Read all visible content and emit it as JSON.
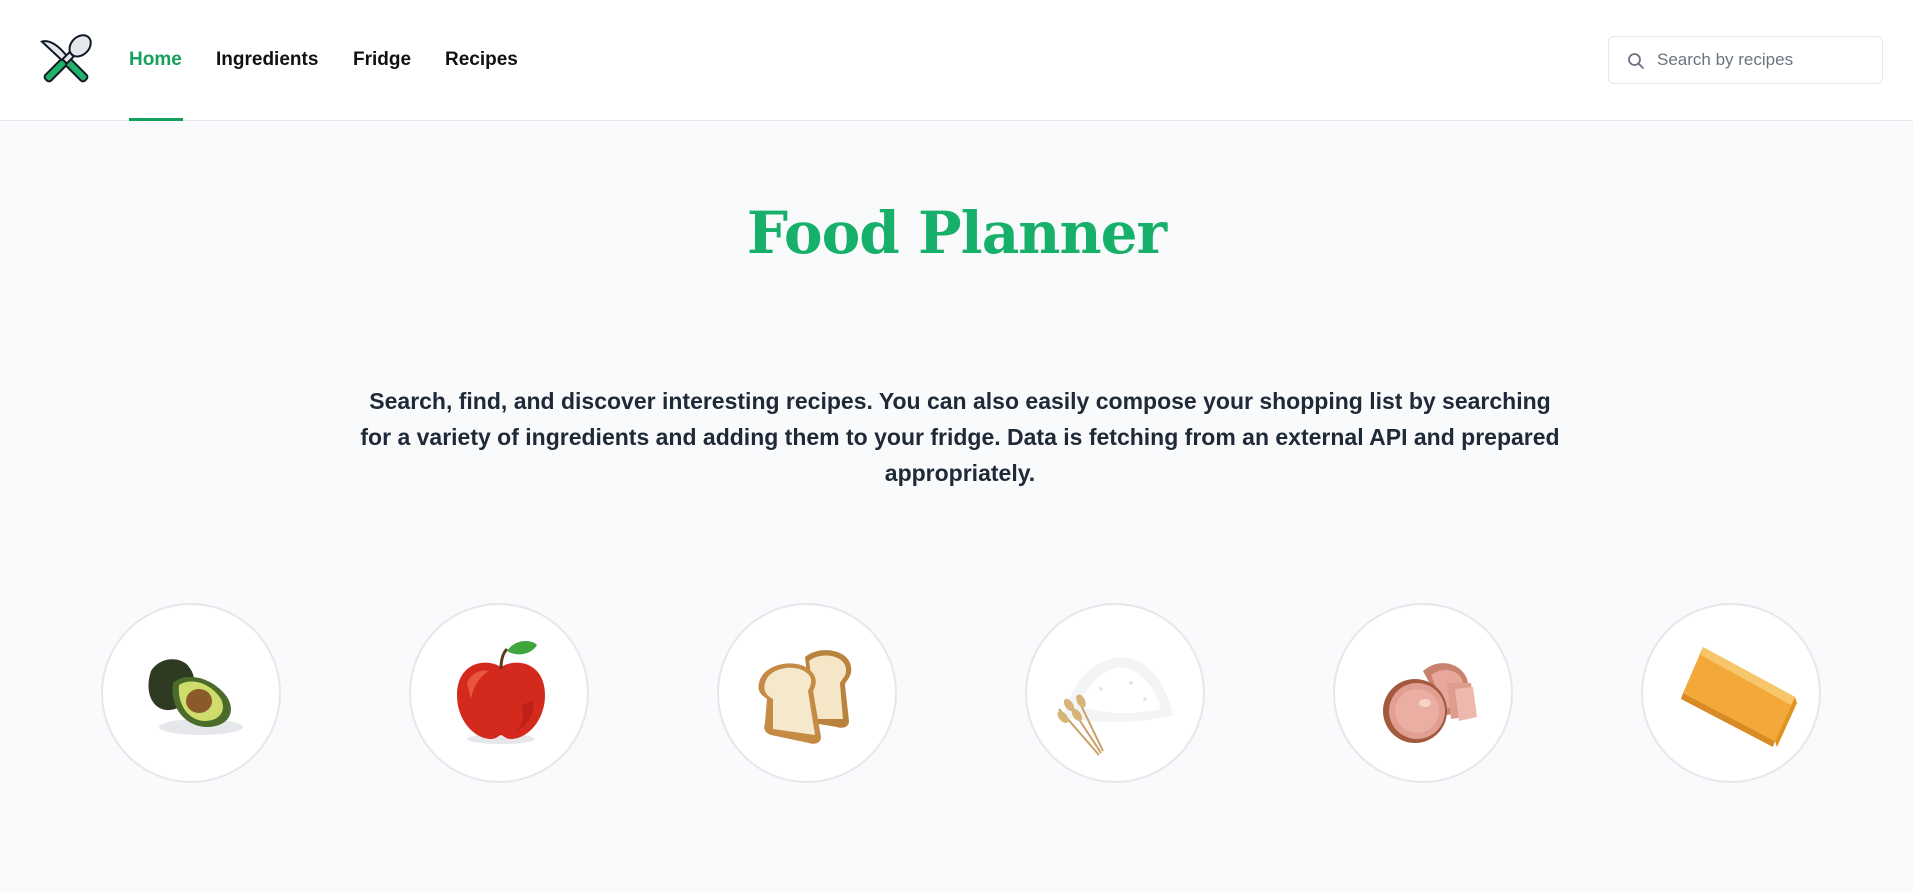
{
  "brand": {
    "logo_icon": "crossed-knife-spoon-icon",
    "accent_color": "#16a05d"
  },
  "nav": {
    "items": [
      {
        "label": "Home",
        "active": true
      },
      {
        "label": "Ingredients",
        "active": false
      },
      {
        "label": "Fridge",
        "active": false
      },
      {
        "label": "Recipes",
        "active": false
      }
    ]
  },
  "search": {
    "placeholder": "Search by recipes",
    "value": "",
    "icon": "search-icon"
  },
  "hero": {
    "title": "Food Planner",
    "title_color": "#16b06a",
    "description": "Search, find, and discover interesting recipes. You can also easily compose your shopping list by searching for a variety of ingredients and adding them to your fridge. Data is fetching from an external API and prepared appropriately."
  },
  "ingredients": [
    {
      "icon": "avocado-icon"
    },
    {
      "icon": "apple-icon"
    },
    {
      "icon": "bread-icon"
    },
    {
      "icon": "flour-icon"
    },
    {
      "icon": "ham-icon"
    },
    {
      "icon": "cheese-icon"
    }
  ]
}
